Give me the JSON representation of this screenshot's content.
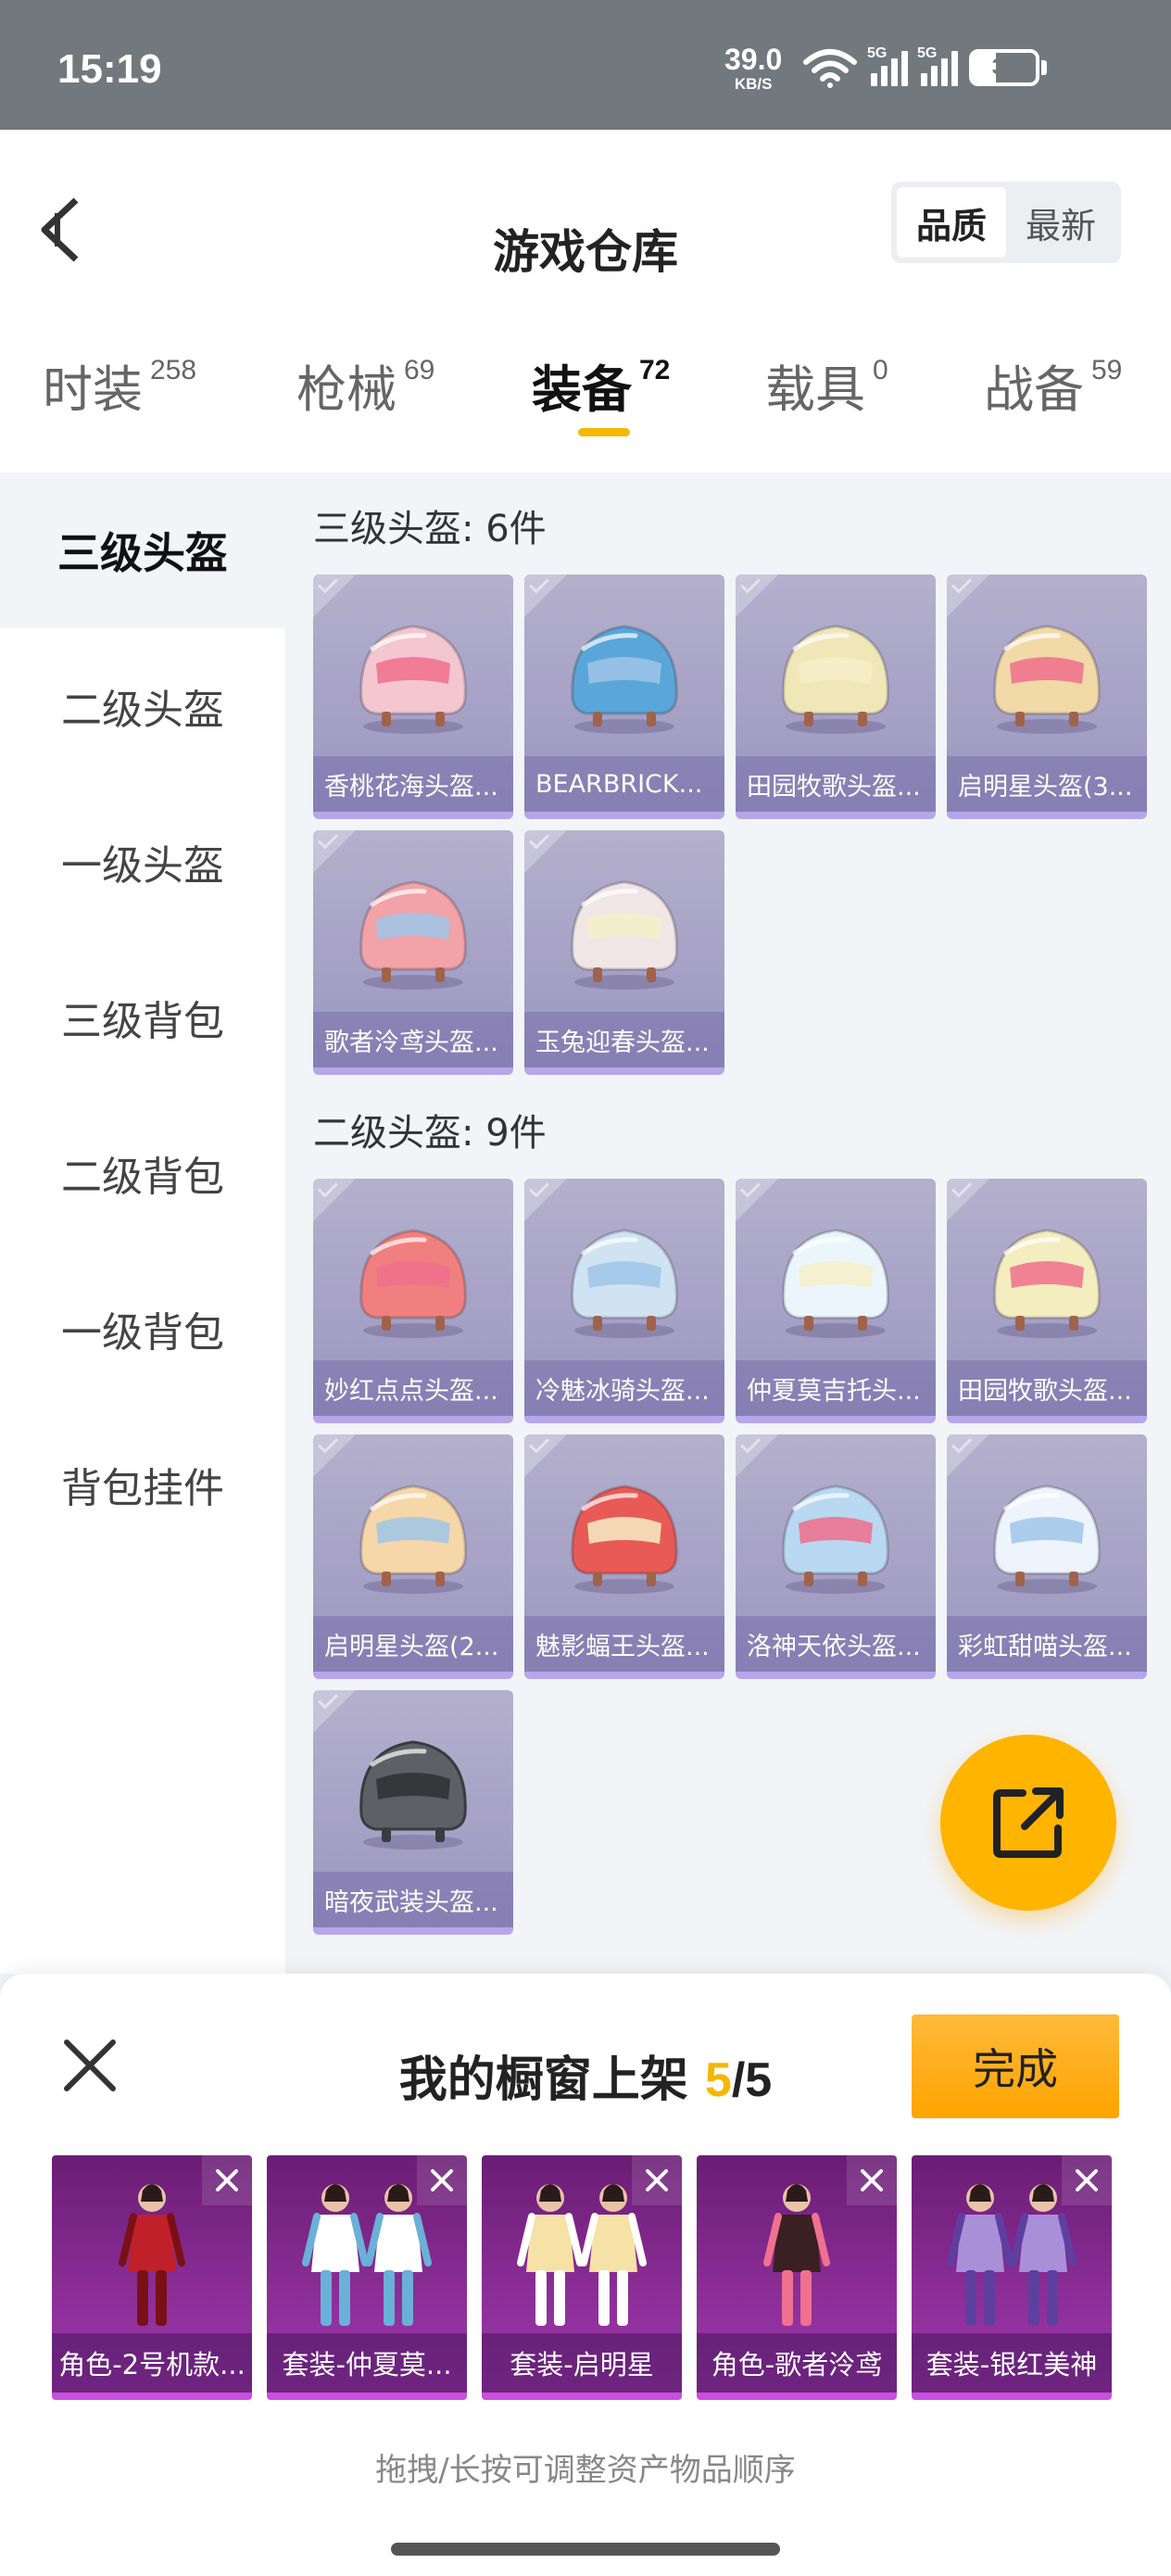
{
  "status_bar": {
    "time": "15:19",
    "speed_value": "39.0",
    "speed_unit": "KB/S",
    "signal1_tag": "5G",
    "signal2_tag": "5G",
    "battery": "37"
  },
  "header": {
    "title": "游戏仓库",
    "sort_quality": "品质",
    "sort_latest": "最新"
  },
  "tabs": [
    {
      "label": "时装",
      "count": "258"
    },
    {
      "label": "枪械",
      "count": "69"
    },
    {
      "label": "装备",
      "count": "72"
    },
    {
      "label": "载具",
      "count": "0"
    },
    {
      "label": "战备",
      "count": "59"
    }
  ],
  "sidebar": [
    {
      "label": "三级头盔"
    },
    {
      "label": "二级头盔"
    },
    {
      "label": "一级头盔"
    },
    {
      "label": "三级背包"
    },
    {
      "label": "二级背包"
    },
    {
      "label": "一级背包"
    },
    {
      "label": "背包挂件"
    }
  ],
  "sections": [
    {
      "title": "三级头盔: 6件",
      "items": [
        {
          "label": "香桃花海头盔...",
          "color": "#f4c6cf"
        },
        {
          "label": "BEARBRICK...",
          "color": "#5aa6d8"
        },
        {
          "label": "田园牧歌头盔...",
          "color": "#efe7b8"
        },
        {
          "label": "启明星头盔(3...",
          "color": "#f2d9a8"
        },
        {
          "label": "歌者泠鸢头盔...",
          "color": "#f1a3a8"
        },
        {
          "label": "玉兔迎春头盔...",
          "color": "#f0e6e6"
        }
      ]
    },
    {
      "title": "二级头盔: 9件",
      "items": [
        {
          "label": "妙红点点头盔...",
          "color": "#f0807f"
        },
        {
          "label": "冷魅冰骑头盔...",
          "color": "#cfe3f2"
        },
        {
          "label": "仲夏莫吉托头...",
          "color": "#eaf6fb"
        },
        {
          "label": "田园牧歌头盔...",
          "color": "#f3edc0"
        },
        {
          "label": "启明星头盔(2...",
          "color": "#f6d7a9"
        },
        {
          "label": "魅影蝠王头盔...",
          "color": "#e85a55"
        },
        {
          "label": "洛神天依头盔...",
          "color": "#b9d8f2"
        },
        {
          "label": "彩虹甜喵头盔...",
          "color": "#eef4fb"
        },
        {
          "label": "暗夜武装头盔...",
          "color": "#5e6066"
        }
      ]
    }
  ],
  "panel": {
    "title": "我的橱窗上架",
    "current": "5",
    "total": "/5",
    "done": "完成",
    "hint": "拖拽/长按可调整资产物品顺序",
    "items": [
      {
        "label": "角色-2号机款..."
      },
      {
        "label": "套装-仲夏莫..."
      },
      {
        "label": "套装-启明星"
      },
      {
        "label": "角色-歌者泠鸢"
      },
      {
        "label": "套装-银红美神"
      }
    ]
  }
}
